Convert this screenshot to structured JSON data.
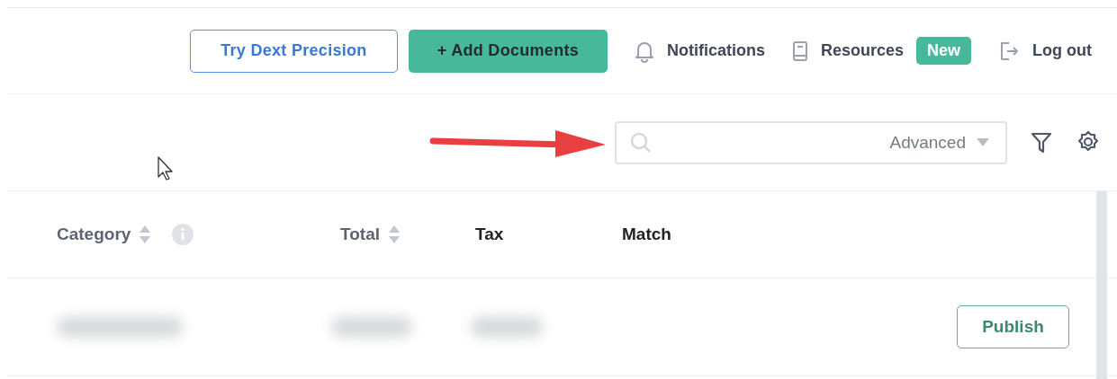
{
  "header": {
    "buttons": [
      {
        "label": "Try Dext Precision",
        "kind": "outline"
      },
      {
        "label": "+ Add Documents",
        "kind": "primary"
      }
    ],
    "links": [
      {
        "label": "Notifications",
        "kind": "bell"
      },
      {
        "label": "Resources",
        "kind": "book",
        "badge": "New"
      },
      {
        "label": "Log out",
        "kind": "logout"
      }
    ]
  },
  "search": {
    "dropdown": "Advanced"
  },
  "table": {
    "columns": [
      {
        "label": "Category",
        "sortable": true,
        "info": true
      },
      {
        "label": "Total",
        "sortable": true,
        "info": false
      },
      {
        "label": "Tax",
        "sortable": false,
        "info": false
      },
      {
        "label": "Match",
        "sortable": false,
        "info": false
      }
    ],
    "rows": [
      {
        "action": "Publish"
      }
    ]
  }
}
